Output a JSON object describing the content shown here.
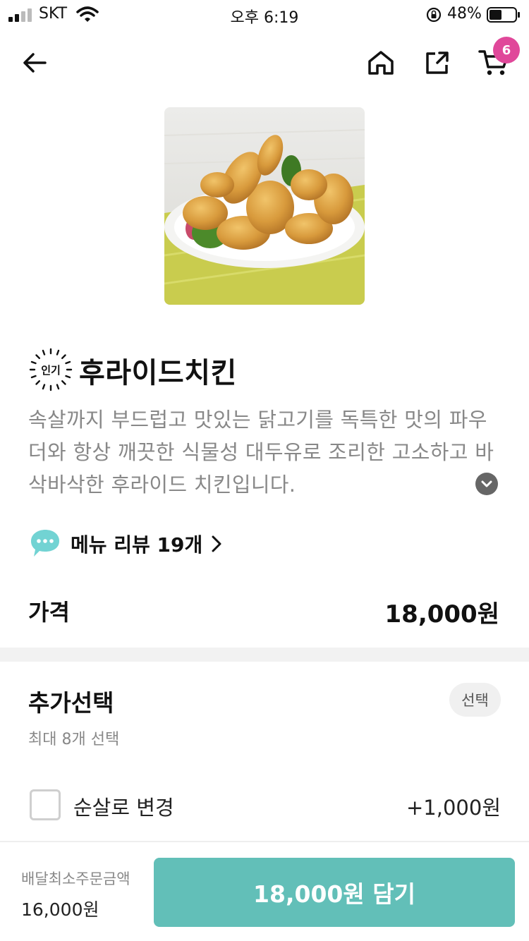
{
  "status_bar": {
    "carrier": "SKT",
    "time": "오후 6:19",
    "battery_percent": "48%",
    "battery_level": 0.48
  },
  "nav": {
    "cart_count": "6"
  },
  "product": {
    "badge": "인기",
    "name": "후라이드치킨",
    "description": "속살까지 부드럽고 맛있는 닭고기를 독특한 맛의 파우더와 항상 깨끗한 식물성 대두유로 조리한 고소하고 바삭바삭한 후라이드 치킨입니다.",
    "review_label": "메뉴 리뷰 19개",
    "price_label": "가격",
    "price": "18,000원"
  },
  "options": {
    "title": "추가선택",
    "tag": "선택",
    "subtitle": "최대 8개 선택",
    "items": [
      {
        "name": "순살로 변경",
        "price": "+1,000원",
        "checked": false
      }
    ]
  },
  "bottom": {
    "min_order_label": "배달최소주문금액",
    "min_order_value": "16,000원",
    "add_button_label": "18,000원 담기"
  },
  "colors": {
    "accent": "#62bfb8",
    "badge": "#e0489a"
  }
}
